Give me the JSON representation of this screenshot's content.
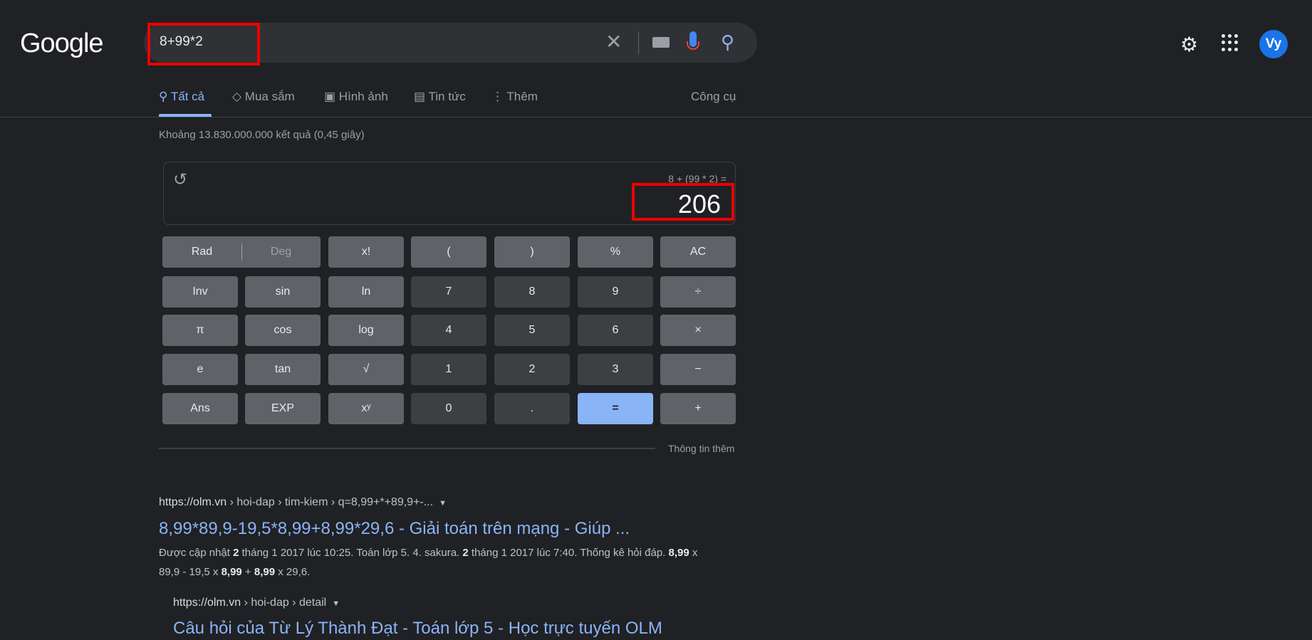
{
  "header": {
    "logo": "Google",
    "query": "8+99*2",
    "avatar": "Vy",
    "icons": [
      "clear-icon",
      "keyboard-icon",
      "mic-icon",
      "search-icon",
      "settings-icon",
      "apps-icon"
    ]
  },
  "tabs": [
    {
      "label": "Tất cả",
      "icon": "search-icon",
      "active": true
    },
    {
      "label": "Mua sắm",
      "icon": "tag-icon"
    },
    {
      "label": "Hình ảnh",
      "icon": "image-icon"
    },
    {
      "label": "Tin tức",
      "icon": "news-icon"
    },
    {
      "label": "Thêm",
      "icon": "more-vert-icon"
    }
  ],
  "tools": "Công cụ",
  "stats": "Khoảng 13.830.000.000 kết quả (0,45 giây)",
  "calculator": {
    "expression": "8 + (99 * 2) =",
    "result": "206",
    "rad": "Rad",
    "deg": "Deg",
    "rows": [
      [
        "x!",
        "(",
        ")",
        "%",
        "AC"
      ],
      [
        "Inv",
        "sin",
        "ln",
        "7",
        "8",
        "9",
        "÷"
      ],
      [
        "π",
        "cos",
        "log",
        "4",
        "5",
        "6",
        "×"
      ],
      [
        "e",
        "tan",
        "√",
        "1",
        "2",
        "3",
        "−"
      ],
      [
        "Ans",
        "EXP",
        "xʸ",
        "0",
        ".",
        "=",
        "+"
      ]
    ],
    "more_info": "Thông tin thêm"
  },
  "results": [
    {
      "host": "https://olm.vn",
      "path": " › hoi-dap › tim-kiem › q=8,99+*+89,9+-...",
      "title": "8,99*89,9-19,5*8,99+8,99*29,6 - Giải toán trên mạng - Giúp ...",
      "snippet": [
        "Được cập nhật ",
        "2",
        " tháng 1 2017 lúc 10:25. Toán lớp 5. 4. sakura. ",
        "2",
        " tháng 1 2017 lúc 7:40. Thống kê hỏi đáp. ",
        "8,99",
        " x 89,9 - 19,5 x ",
        "8,99",
        " + ",
        "8,99",
        " x 29,6."
      ]
    },
    {
      "host": "https://olm.vn",
      "path": " › hoi-dap › detail",
      "title": "Câu hỏi của Từ Lý Thành Đạt - Toán lớp 5 - Học trực tuyến OLM"
    }
  ],
  "colors": {
    "background": "#202124",
    "link": "#8ab4f8",
    "equals": "#8ab4f8",
    "highlight": "#ee0000"
  }
}
